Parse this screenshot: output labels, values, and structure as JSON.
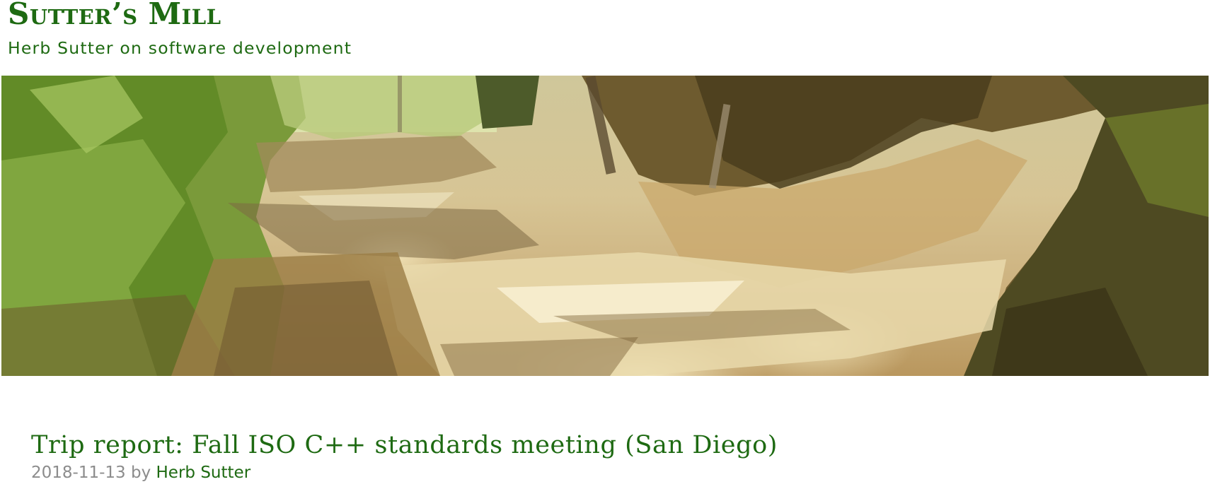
{
  "site": {
    "title": "Sutter’s Mill",
    "tagline": "Herb Sutter on software development"
  },
  "banner": {
    "description_icon": "header-photo-forest-trail"
  },
  "post": {
    "title": "Trip report: Fall ISO C++ standards meeting (San Diego)",
    "date": "2018-11-13",
    "by": "by",
    "author": "Herb Sutter"
  },
  "colors": {
    "accent": "#1e6a12",
    "meta_gray": "#8c8c8c",
    "background": "#ffffff"
  }
}
